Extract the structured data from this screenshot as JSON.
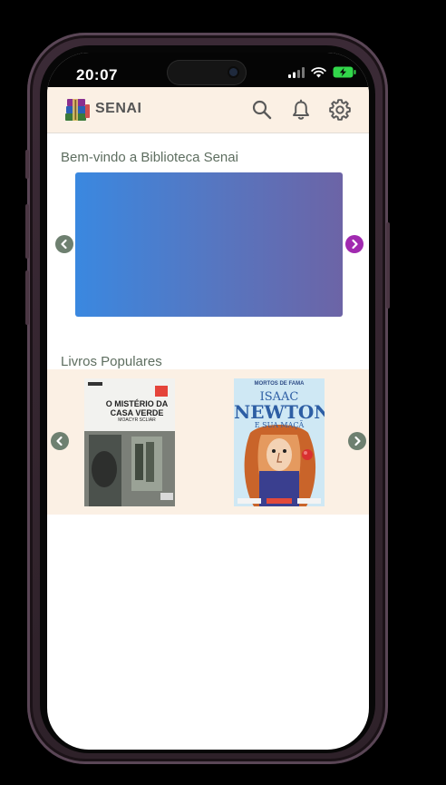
{
  "status_bar": {
    "time": "20:07"
  },
  "app_bar": {
    "brand": "SENAI",
    "icons": [
      "search-icon",
      "bell-icon",
      "gear-icon"
    ]
  },
  "welcome": {
    "title": "Bem-vindo a Biblioteca Senai",
    "banner_gradient": [
      "#3a88e0",
      "#6c64a6"
    ]
  },
  "popular": {
    "title": "Livros Populares",
    "books": [
      {
        "cover_title": "O MISTÉRIO DA CASA VERDE",
        "cover_author": "MOACYR SCLIAR"
      },
      {
        "cover_series": "MORTOS DE FAMA",
        "cover_title_1": "ISAAC",
        "cover_title_2": "NEWTON",
        "cover_subtitle": "E SUA MAÇÃ"
      }
    ]
  },
  "colors": {
    "appbar_bg": "#fbf0e4",
    "arrow_green": "#6e8070",
    "arrow_purple": "#a12ab0",
    "section_title": "#5e6e60"
  }
}
